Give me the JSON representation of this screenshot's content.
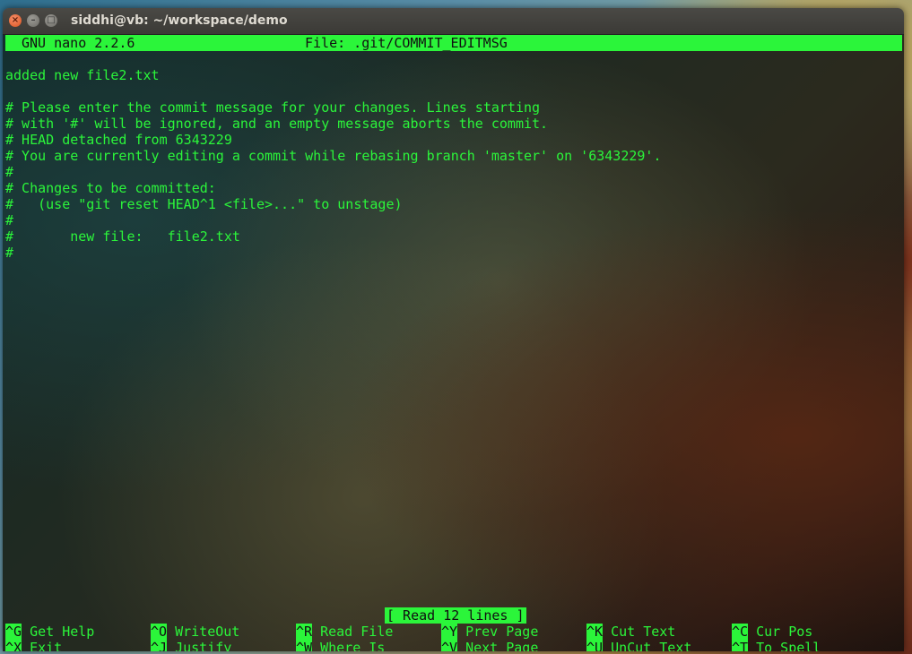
{
  "window": {
    "title": "siddhi@vb: ~/workspace/demo",
    "close_glyph": "×",
    "min_glyph": "–",
    "max_glyph": "□"
  },
  "nano": {
    "version": "GNU nano 2.2.6",
    "file": "File: .git/COMMIT_EDITMSG",
    "lines": [
      "added new file2.txt",
      "",
      "# Please enter the commit message for your changes. Lines starting",
      "# with '#' will be ignored, and an empty message aborts the commit.",
      "# HEAD detached from 6343229",
      "# You are currently editing a commit while rebasing branch 'master' on '6343229'.",
      "#",
      "# Changes to be committed:",
      "#   (use \"git reset HEAD^1 <file>...\" to unstage)",
      "#",
      "#       new file:   file2.txt",
      "#"
    ],
    "status": "[ Read 12 lines ]",
    "shortcuts_row1": [
      {
        "key": "^G",
        "label": "Get Help"
      },
      {
        "key": "^O",
        "label": "WriteOut"
      },
      {
        "key": "^R",
        "label": "Read File"
      },
      {
        "key": "^Y",
        "label": "Prev Page"
      },
      {
        "key": "^K",
        "label": "Cut Text"
      },
      {
        "key": "^C",
        "label": "Cur Pos"
      }
    ],
    "shortcuts_row2": [
      {
        "key": "^X",
        "label": "Exit"
      },
      {
        "key": "^J",
        "label": "Justify"
      },
      {
        "key": "^W",
        "label": "Where Is"
      },
      {
        "key": "^V",
        "label": "Next Page"
      },
      {
        "key": "^U",
        "label": "UnCut Text"
      },
      {
        "key": "^T",
        "label": "To Spell"
      }
    ]
  },
  "colors": {
    "terminal_fg": "#2bf53a",
    "highlight_bg": "#2bf53a"
  }
}
